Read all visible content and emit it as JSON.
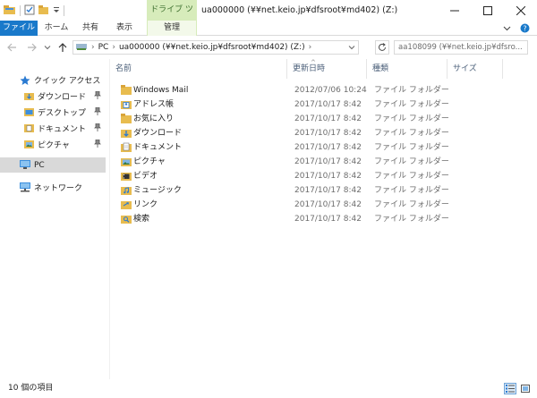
{
  "window": {
    "title": "ua000000 (¥¥net.keio.jp¥dfsroot¥md402) (Z:)",
    "context_tab": "ドライブ ツール",
    "controls": [
      "minimize",
      "maximize",
      "close"
    ]
  },
  "ribbon": {
    "file_tab": "ファイル",
    "tabs": [
      "ホーム",
      "共有",
      "表示"
    ],
    "manage_tab": "管理"
  },
  "address": {
    "segments": [
      "PC",
      "ua000000 (¥¥net.keio.jp¥dfsroot¥md402) (Z:)"
    ],
    "search_placeholder": "aa108099 (¥¥net.keio.jp¥dfsro..."
  },
  "nav": {
    "quick_access": "クイック アクセス",
    "pinned": [
      "ダウンロード",
      "デスクトップ",
      "ドキュメント",
      "ピクチャ"
    ],
    "pc": "PC",
    "network": "ネットワーク"
  },
  "columns": [
    "名前",
    "更新日時",
    "種類",
    "サイズ"
  ],
  "files": [
    {
      "name": "Windows Mail",
      "date": "2012/07/06 10:24",
      "type": "ファイル フォルダー",
      "icon": "folder-icon"
    },
    {
      "name": "アドレス帳",
      "date": "2017/10/17 8:42",
      "type": "ファイル フォルダー",
      "icon": "contacts-icon"
    },
    {
      "name": "お気に入り",
      "date": "2017/10/17 8:42",
      "type": "ファイル フォルダー",
      "icon": "favorites-icon"
    },
    {
      "name": "ダウンロード",
      "date": "2017/10/17 8:42",
      "type": "ファイル フォルダー",
      "icon": "download-icon"
    },
    {
      "name": "ドキュメント",
      "date": "2017/10/17 8:42",
      "type": "ファイル フォルダー",
      "icon": "documents-icon"
    },
    {
      "name": "ピクチャ",
      "date": "2017/10/17 8:42",
      "type": "ファイル フォルダー",
      "icon": "pictures-icon"
    },
    {
      "name": "ビデオ",
      "date": "2017/10/17 8:42",
      "type": "ファイル フォルダー",
      "icon": "videos-icon"
    },
    {
      "name": "ミュージック",
      "date": "2017/10/17 8:42",
      "type": "ファイル フォルダー",
      "icon": "music-icon"
    },
    {
      "name": "リンク",
      "date": "2017/10/17 8:42",
      "type": "ファイル フォルダー",
      "icon": "links-icon"
    },
    {
      "name": "検索",
      "date": "2017/10/17 8:42",
      "type": "ファイル フォルダー",
      "icon": "search-folder-icon"
    }
  ],
  "status": {
    "item_count": "10 個の項目"
  },
  "colors": {
    "accent": "#1979ca",
    "context_tab_bg": "#d7ecbb",
    "folder": "#e8bc4f",
    "selection": "#d9d9d9"
  }
}
